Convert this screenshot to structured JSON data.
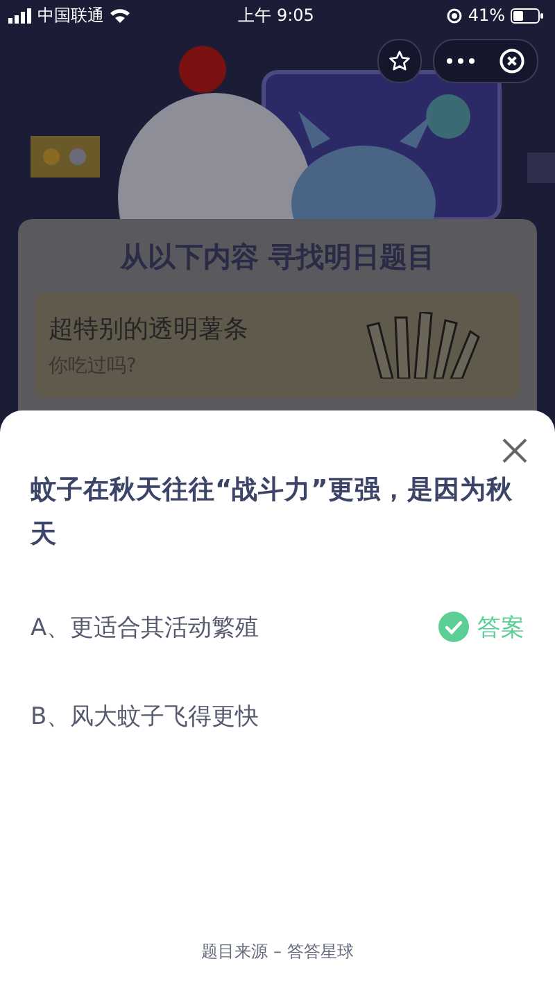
{
  "status_bar": {
    "carrier": "中国联通",
    "time": "上午 9:05",
    "battery": "41%"
  },
  "banner": {
    "title": "从以下内容 寻找明日题目"
  },
  "article": {
    "title": "超特别的透明薯条",
    "subtitle": "你吃过吗?"
  },
  "question": {
    "text": "蚊子在秋天往往“战斗力”更强，是因为秋天",
    "options": [
      {
        "label": "A、更适合其活动繁殖",
        "correct": true,
        "badge": "答案"
      },
      {
        "label": "B、风大蚊子飞得更快",
        "correct": false
      }
    ]
  },
  "footer": "题目来源 – 答答星球"
}
